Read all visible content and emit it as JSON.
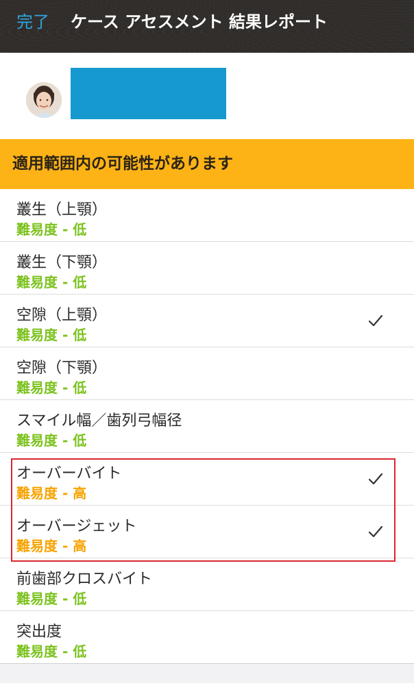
{
  "nav": {
    "done_label": "完了",
    "title": "ケース アセスメント 結果レポート"
  },
  "banner": {
    "text": "適用範囲内の可能性があります"
  },
  "items": [
    {
      "title": "叢生（上顎）",
      "difficulty": "難易度 - 低",
      "level": "low",
      "checked": false
    },
    {
      "title": "叢生（下顎）",
      "difficulty": "難易度 - 低",
      "level": "low",
      "checked": false
    },
    {
      "title": "空隙（上顎）",
      "difficulty": "難易度 - 低",
      "level": "low",
      "checked": true
    },
    {
      "title": "空隙（下顎）",
      "difficulty": "難易度 - 低",
      "level": "low",
      "checked": false
    },
    {
      "title": "スマイル幅／歯列弓幅径",
      "difficulty": "難易度 - 低",
      "level": "low",
      "checked": false
    },
    {
      "title": "オーバーバイト",
      "difficulty": "難易度 - 高",
      "level": "high",
      "checked": true
    },
    {
      "title": "オーバージェット",
      "difficulty": "難易度 - 高",
      "level": "high",
      "checked": true
    },
    {
      "title": "前歯部クロスバイト",
      "difficulty": "難易度 - 低",
      "level": "low",
      "checked": false
    },
    {
      "title": "突出度",
      "difficulty": "難易度 - 低",
      "level": "low",
      "checked": false
    }
  ],
  "colors": {
    "accent": "#2fa6e0",
    "banner": "#fdb316",
    "low": "#7cc21e",
    "high": "#f7a300",
    "highlight": "#d9262f",
    "name_redaction": "#1599cf"
  },
  "icons": {
    "check": "checkmark-icon"
  }
}
